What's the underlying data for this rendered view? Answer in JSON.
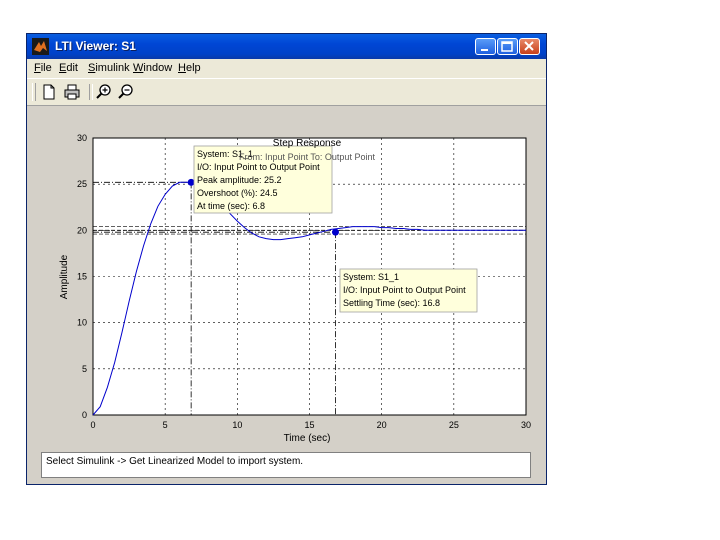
{
  "window": {
    "title": "LTI Viewer: S1"
  },
  "menu": [
    {
      "hot": "F",
      "rest": "ile"
    },
    {
      "hot": "E",
      "rest": "dit"
    },
    {
      "hot": "S",
      "rest": "imulink"
    },
    {
      "hot": "W",
      "rest": "indow"
    },
    {
      "hot": "H",
      "rest": "elp"
    }
  ],
  "toolbar": {
    "icons": [
      "new-document-icon",
      "print-icon",
      "zoom-in-icon",
      "zoom-out-icon"
    ]
  },
  "chart_data": {
    "type": "line",
    "title": "Step Response",
    "subtitle": "From: Input Point  To: Output Point",
    "xlabel": "Time (sec)",
    "ylabel": "Amplitude",
    "xlim": [
      0,
      30
    ],
    "ylim": [
      0,
      30
    ],
    "xticks": [
      0,
      5,
      10,
      15,
      20,
      25,
      30
    ],
    "yticks": [
      0,
      5,
      10,
      15,
      20,
      25,
      30
    ],
    "grid": true,
    "color": "#0000cc",
    "series": [
      {
        "x": [
          0,
          0.5,
          1,
          1.5,
          2,
          2.5,
          3,
          3.5,
          4,
          4.5,
          5,
          5.5,
          6,
          6.5,
          7,
          7.5,
          8,
          8.5,
          9,
          9.5,
          10,
          10.5,
          11,
          11.5,
          12,
          12.5,
          13,
          13.5,
          14,
          14.5,
          15,
          15.5,
          16,
          16.5,
          17,
          17.5,
          18,
          18.5,
          19,
          19.5,
          20,
          20.5,
          21,
          21.5,
          22,
          22.5,
          23,
          23.5,
          24,
          25,
          26,
          27,
          28,
          29,
          30
        ],
        "y": [
          0,
          0.9,
          3.0,
          5.7,
          8.9,
          12.3,
          15.5,
          18.3,
          20.7,
          22.6,
          23.9,
          24.8,
          25.2,
          25.2,
          25.1,
          24.8,
          24.2,
          23.5,
          22.6,
          21.8,
          21.0,
          20.3,
          19.7,
          19.3,
          19.1,
          19.0,
          19.0,
          19.1,
          19.2,
          19.3,
          19.5,
          19.7,
          19.9,
          20.1,
          20.2,
          20.3,
          20.4,
          20.4,
          20.4,
          20.4,
          20.3,
          20.3,
          20.2,
          20.2,
          20.1,
          20.1,
          20.0,
          20.0,
          20.0,
          20.0,
          20.0,
          20.0,
          20.0,
          20.0,
          20.0
        ]
      }
    ],
    "final_value": 20,
    "settling_band": [
      19.6,
      20.4
    ],
    "markers": [
      {
        "x": 6.8,
        "y": 25.2
      },
      {
        "x": 16.8,
        "y": 19.8
      }
    ],
    "annotations": [
      {
        "lines": [
          "System: S1_1",
          "I/O: Input Point to Output Point",
          "Peak amplitude: 25.2",
          "Overshoot (%): 24.5",
          "At time (sec): 6.8"
        ]
      },
      {
        "lines": [
          "System: S1_1",
          "I/O: Input Point to Output Point",
          "Settling Time (sec): 16.8"
        ]
      }
    ]
  },
  "status": {
    "text": "Select Simulink -> Get Linearized Model to import system."
  }
}
